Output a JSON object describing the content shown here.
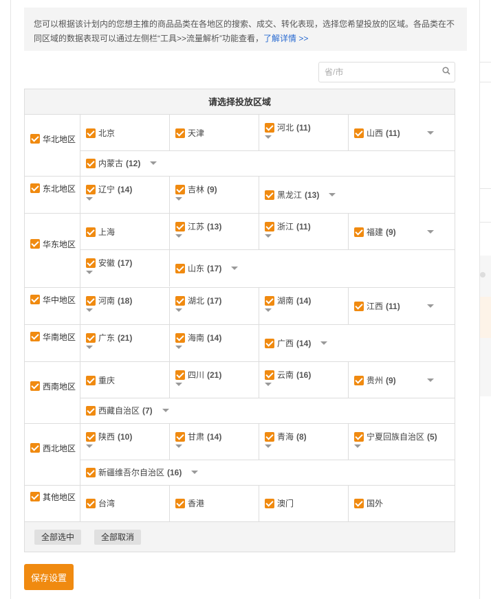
{
  "notice": {
    "text": "您可以根据该计划内的您想主推的商品品类在各地区的搜索、成交、转化表现，选择您希望投放的区域。各品类在不同区域的数据表现可以通过左侧栏“工具>>流量解析”功能查看，",
    "link": "了解详情 >>"
  },
  "search": {
    "placeholder": "省/市",
    "icon": "search-icon"
  },
  "table": {
    "title": "请选择投放区域",
    "regions": [
      {
        "name": "华北地区",
        "provinces": [
          {
            "name": "北京"
          },
          {
            "name": "天津"
          },
          {
            "name": "河北",
            "count": "(11)"
          },
          {
            "name": "山西",
            "count": "(11)"
          },
          {
            "name": "内蒙古",
            "count": "(12)"
          }
        ]
      },
      {
        "name": "东北地区",
        "provinces": [
          {
            "name": "辽宁",
            "count": "(14)"
          },
          {
            "name": "吉林",
            "count": "(9)"
          },
          {
            "name": "黑龙江",
            "count": "(13)"
          }
        ]
      },
      {
        "name": "华东地区",
        "provinces": [
          {
            "name": "上海"
          },
          {
            "name": "江苏",
            "count": "(13)"
          },
          {
            "name": "浙江",
            "count": "(11)"
          },
          {
            "name": "福建",
            "count": "(9)"
          },
          {
            "name": "安徽",
            "count": "(17)"
          },
          {
            "name": "山东",
            "count": "(17)"
          }
        ]
      },
      {
        "name": "华中地区",
        "provinces": [
          {
            "name": "河南",
            "count": "(18)"
          },
          {
            "name": "湖北",
            "count": "(17)"
          },
          {
            "name": "湖南",
            "count": "(14)"
          },
          {
            "name": "江西",
            "count": "(11)"
          }
        ]
      },
      {
        "name": "华南地区",
        "provinces": [
          {
            "name": "广东",
            "count": "(21)"
          },
          {
            "name": "海南",
            "count": "(14)"
          },
          {
            "name": "广西",
            "count": "(14)"
          }
        ]
      },
      {
        "name": "西南地区",
        "provinces": [
          {
            "name": "重庆"
          },
          {
            "name": "四川",
            "count": "(21)"
          },
          {
            "name": "云南",
            "count": "(16)"
          },
          {
            "name": "贵州",
            "count": "(9)"
          },
          {
            "name": "西藏自治区",
            "count": "(7)"
          }
        ]
      },
      {
        "name": "西北地区",
        "provinces": [
          {
            "name": "陕西",
            "count": "(10)"
          },
          {
            "name": "甘肃",
            "count": "(14)"
          },
          {
            "name": "青海",
            "count": "(8)"
          },
          {
            "name": "宁夏回族自治区",
            "count": "(5)"
          },
          {
            "name": "新疆维吾尔自治区",
            "count": "(16)"
          }
        ]
      },
      {
        "name": "其他地区",
        "provinces": [
          {
            "name": "台湾"
          },
          {
            "name": "香港"
          },
          {
            "name": "澳门"
          },
          {
            "name": "国外"
          }
        ]
      }
    ],
    "select_all": "全部选中",
    "deselect_all": "全部取消"
  },
  "save_button": "保存设置",
  "colors": {
    "accent": "#f08a10",
    "link": "#2a6bd1"
  }
}
